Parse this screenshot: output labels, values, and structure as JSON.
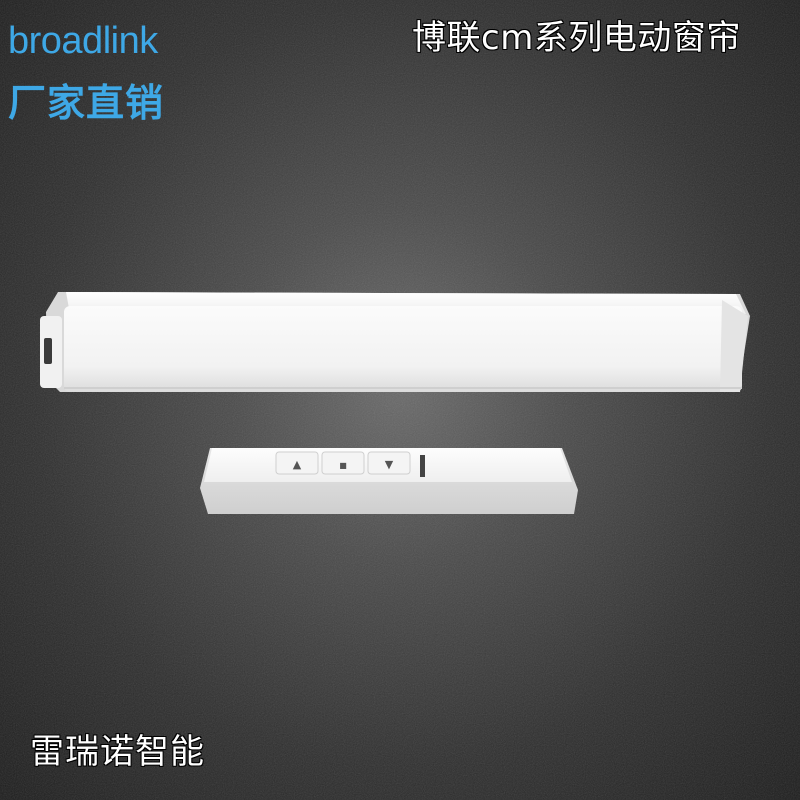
{
  "brand": {
    "logo_text": "broadlink",
    "tagline": "厂家直销"
  },
  "product": {
    "title": "博联cm系列电动窗帘"
  },
  "shop": {
    "name": "雷瑞诺智能"
  },
  "remote": {
    "buttons": [
      "▲",
      "■",
      "▼"
    ]
  },
  "colors": {
    "brand_blue": "#3ea8e6",
    "device_white": "#f7f7f7"
  }
}
